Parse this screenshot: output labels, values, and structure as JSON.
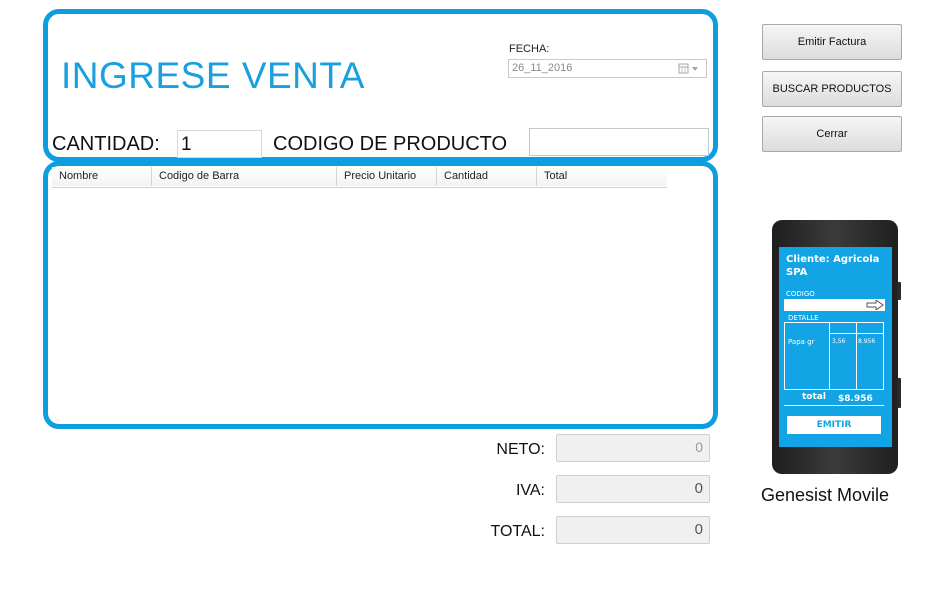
{
  "header": {
    "title": "INGRESE VENTA"
  },
  "fecha": {
    "label": "FECHA:",
    "value": "26_11_2016"
  },
  "entry": {
    "cantidad_label": "CANTIDAD:",
    "cantidad_value": "1",
    "codigo_label": "CODIGO DE PRODUCTO",
    "codigo_value": ""
  },
  "grid": {
    "columns": [
      "Nombre",
      "Codigo de Barra",
      "Precio Unitario",
      "Cantidad",
      "Total"
    ]
  },
  "buttons": {
    "emitir": "Emitir Factura",
    "buscar": "BUSCAR PRODUCTOS",
    "cerrar": "Cerrar"
  },
  "totals": {
    "neto_label": "NETO:",
    "neto_value": "0",
    "iva_label": "IVA:",
    "iva_value": "0",
    "total_label": "TOTAL:",
    "total_value": "0"
  },
  "phone": {
    "cliente": "Cliente: Agricola SPA",
    "codigo_label": "CODIGO",
    "detalle_label": "DETALLE",
    "item_name": "Papa gr",
    "item_price": "3,56",
    "item_total": "8.956",
    "total_label": "total",
    "total_value": "$8.956",
    "emitir_label": "EMITIR",
    "caption": "Genesist Movile"
  },
  "colors": {
    "accent": "#0d9ee0"
  }
}
